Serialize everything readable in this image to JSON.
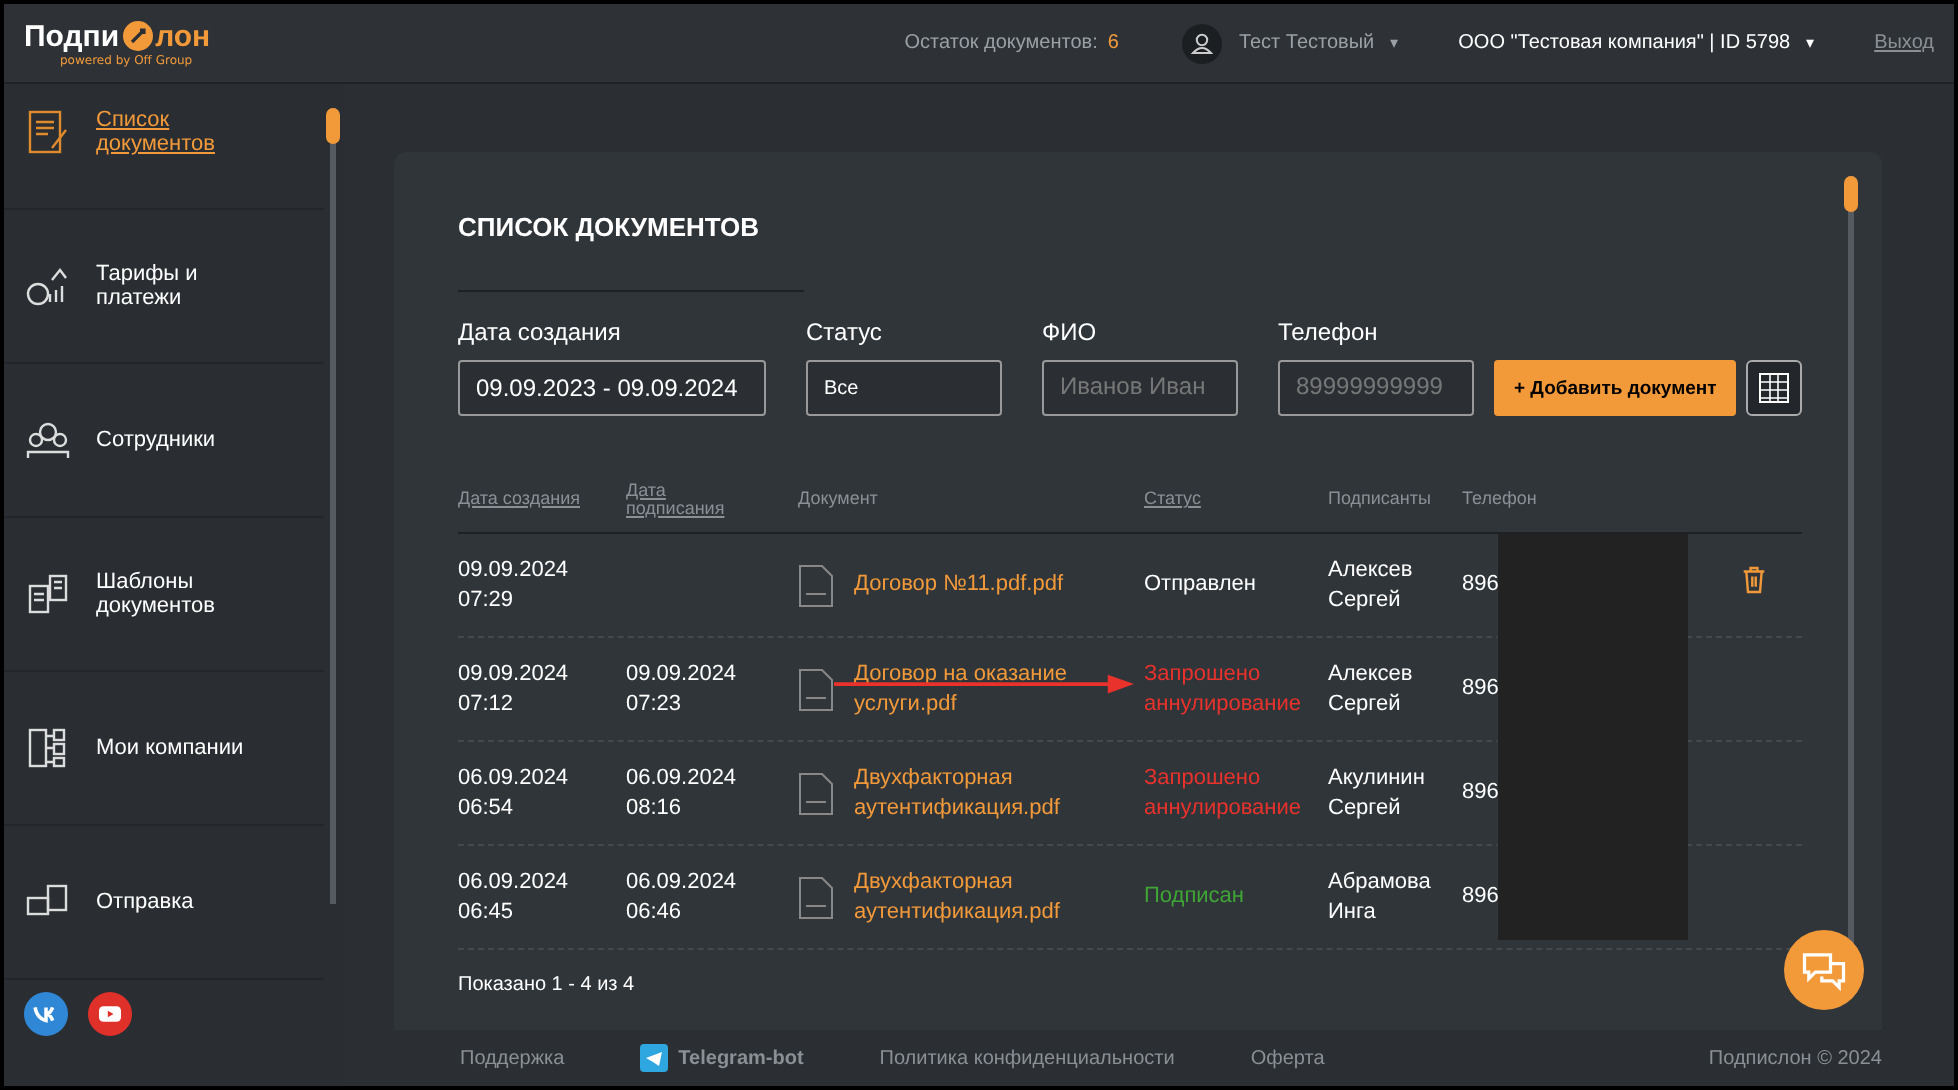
{
  "header": {
    "logo_left": "Подпи",
    "logo_right": "лон",
    "tagline": "powered by Off Group",
    "docs_left_label": "Остаток документов:",
    "docs_left_value": "6",
    "user": "Тест Тестовый",
    "user_caret": "▾",
    "company": "ООО \"Тестовая компания\" | ID 5798",
    "company_caret": "▾",
    "logout": "Выход"
  },
  "sidebar": {
    "items": [
      {
        "label": "Список документов",
        "selected": true
      },
      {
        "label": "Тарифы и платежи",
        "selected": false
      },
      {
        "label": "Сотрудники",
        "selected": false
      },
      {
        "label": "Шаблоны документов",
        "selected": false
      },
      {
        "label": "Мои компании",
        "selected": false
      },
      {
        "label": "Отправка",
        "selected": false
      }
    ]
  },
  "page": {
    "title": "СПИСОК ДОКУМЕНТОВ",
    "filters": [
      {
        "label": "Дата создания",
        "value": "09.09.2023 - 09.09.2024"
      },
      {
        "label": "Статус",
        "value": "Все"
      },
      {
        "label": "ФИО",
        "placeholder": "Иванов Иван"
      },
      {
        "label": "Телефон",
        "placeholder": "89999999999"
      }
    ],
    "add_button": "+ Добавить документ",
    "table": {
      "columns": [
        {
          "label": "Дата создания",
          "sortable": true
        },
        {
          "label": "Дата подписания",
          "sortable": true
        },
        {
          "label": "Документ",
          "sortable": false
        },
        {
          "label": "Статус",
          "sortable": true
        },
        {
          "label": "Подписанты",
          "sortable": false
        },
        {
          "label": "Телефон",
          "sortable": false
        }
      ],
      "rows": [
        {
          "created": "09.09.2024 07:29",
          "signed": "",
          "document": "Договор №11.pdf.pdf",
          "status": "Отправлен",
          "kind": "sent",
          "signer": "Алексев Сергей",
          "phone": "896",
          "deletable": true
        },
        {
          "created": "09.09.2024 07:12",
          "signed": "09.09.2024 07:23",
          "document": "Договор на оказание услуги.pdf",
          "status": "Запрошено аннулирование",
          "kind": "cancel",
          "signer": "Алексев Сергей",
          "phone": "896",
          "deletable": false
        },
        {
          "created": "06.09.2024 06:54",
          "signed": "06.09.2024 08:16",
          "document": "Двухфакторная аутентификация.pdf",
          "status": "Запрошено аннулирование",
          "kind": "cancel",
          "signer": "Акулинин Сергей",
          "phone": "896",
          "deletable": false
        },
        {
          "created": "06.09.2024 06:45",
          "signed": "06.09.2024 06:46",
          "document": "Двухфакторная аутентификация.pdf",
          "status": "Подписан",
          "kind": "signed",
          "signer": "Абрамова Инга",
          "phone": "896",
          "deletable": false
        }
      ]
    },
    "shown": "Показано 1 - 4 из 4"
  },
  "footer": {
    "links": [
      "Поддержка",
      "Telegram-bot",
      "Политика конфиденциальности",
      "Оферта"
    ],
    "copyright": "Подпислон © 2024"
  }
}
